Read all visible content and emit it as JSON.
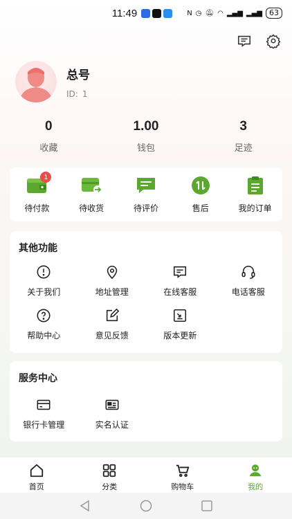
{
  "status_bar": {
    "time": "11:49",
    "battery": "63"
  },
  "profile": {
    "name": "总号",
    "id_label": "ID:",
    "id_value": "1"
  },
  "stats": [
    {
      "value": "0",
      "label": "收藏"
    },
    {
      "value": "1.00",
      "label": "钱包"
    },
    {
      "value": "3",
      "label": "足迹"
    }
  ],
  "orders": [
    {
      "label": "待付款",
      "icon": "wallet-icon",
      "badge": "1"
    },
    {
      "label": "待收货",
      "icon": "receive-icon"
    },
    {
      "label": "待评价",
      "icon": "comment-icon"
    },
    {
      "label": "售后",
      "icon": "after-sales-icon"
    },
    {
      "label": "我的订单",
      "icon": "clipboard-icon"
    }
  ],
  "functions": {
    "title": "其他功能",
    "items": [
      {
        "label": "关于我们",
        "icon": "info-icon"
      },
      {
        "label": "地址管理",
        "icon": "location-icon"
      },
      {
        "label": "在线客服",
        "icon": "chat-icon"
      },
      {
        "label": "电话客服",
        "icon": "headset-icon"
      },
      {
        "label": "帮助中心",
        "icon": "help-icon"
      },
      {
        "label": "意见反馈",
        "icon": "edit-icon"
      },
      {
        "label": "版本更新",
        "icon": "update-icon"
      }
    ]
  },
  "services": {
    "title": "服务中心",
    "items": [
      {
        "label": "银行卡管理",
        "icon": "card-icon"
      },
      {
        "label": "实名认证",
        "icon": "id-card-icon"
      }
    ]
  },
  "tabbar": [
    {
      "label": "首页",
      "icon": "home-icon"
    },
    {
      "label": "分类",
      "icon": "category-icon"
    },
    {
      "label": "购物车",
      "icon": "cart-icon"
    },
    {
      "label": "我的",
      "icon": "user-icon",
      "active": true
    }
  ],
  "colors": {
    "accent": "#5aa82e",
    "badge": "#ef4b4b",
    "avatar": "#f08a86"
  }
}
